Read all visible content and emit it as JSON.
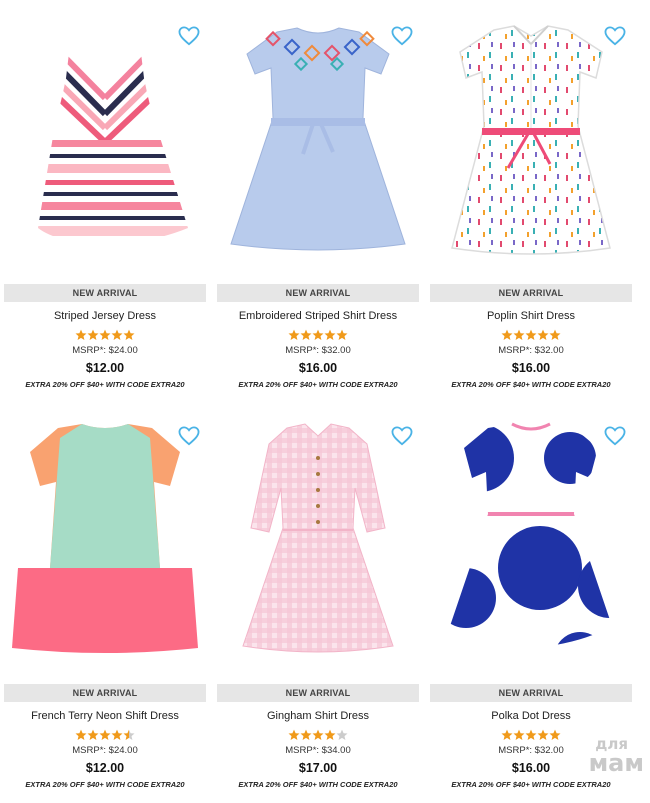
{
  "colors": {
    "heart": "#4ab3e6",
    "star_filled": "#f09a1a",
    "star_empty": "#cccccc",
    "badge_bg": "#e6e6e6"
  },
  "products": [
    {
      "badge": "NEW ARRIVAL",
      "name": "Striped Jersey Dress",
      "rating": 5,
      "msrp": "MSRP*: $24.00",
      "price": "$12.00",
      "promo": "EXTRA 20% OFF $40+ WITH CODE EXTRA20",
      "favorite_icon": "heart-outline-icon"
    },
    {
      "badge": "NEW ARRIVAL",
      "name": "Embroidered Striped Shirt Dress",
      "rating": 5,
      "msrp": "MSRP*: $32.00",
      "price": "$16.00",
      "promo": "EXTRA 20% OFF $40+ WITH CODE EXTRA20",
      "favorite_icon": "heart-outline-icon"
    },
    {
      "badge": "NEW ARRIVAL",
      "name": "Poplin Shirt Dress",
      "rating": 5,
      "msrp": "MSRP*: $32.00",
      "price": "$16.00",
      "promo": "EXTRA 20% OFF $40+ WITH CODE EXTRA20",
      "favorite_icon": "heart-outline-icon"
    },
    {
      "badge": "NEW ARRIVAL",
      "name": "French Terry Neon Shift Dress",
      "rating": 4.5,
      "msrp": "MSRP*: $24.00",
      "price": "$12.00",
      "promo": "EXTRA 20% OFF $40+ WITH CODE EXTRA20",
      "favorite_icon": "heart-outline-icon"
    },
    {
      "badge": "NEW ARRIVAL",
      "name": "Gingham Shirt Dress",
      "rating": 4,
      "msrp": "MSRP*: $34.00",
      "price": "$17.00",
      "promo": "EXTRA 20% OFF $40+ WITH CODE EXTRA20",
      "favorite_icon": "heart-outline-icon"
    },
    {
      "badge": "NEW ARRIVAL",
      "name": "Polka Dot Dress",
      "rating": 5,
      "msrp": "MSRP*: $32.00",
      "price": "$16.00",
      "promo": "EXTRA 20% OFF $40+ WITH CODE EXTRA20",
      "favorite_icon": "heart-outline-icon"
    }
  ],
  "watermark": {
    "line1": "для",
    "line2": "мам"
  }
}
